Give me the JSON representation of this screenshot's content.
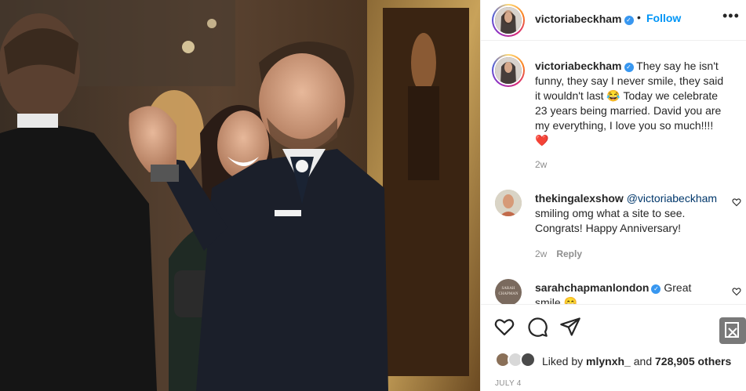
{
  "post": {
    "author": "victoriabeckham",
    "follow_label": "Follow",
    "separator": "•",
    "more_icon": "more-horizontal-icon"
  },
  "caption": {
    "username": "victoriabeckham",
    "lines": [
      "They say he isn't",
      "funny, they say I never smile, they said",
      "it wouldn't last 😂 Today we celebrate",
      "23 years being married. David you are",
      "my everything, I love you so much!!!!",
      "❤️"
    ],
    "time": "2w"
  },
  "comments": [
    {
      "username": "thekingalexshow",
      "lines": [
        "@victoriabeckham",
        "smiling omg what a site to see.",
        "Congrats! Happy Anniversary!"
      ],
      "time": "2w",
      "reply_label": "Reply"
    },
    {
      "username": "sarahchapmanlondon",
      "lines": [
        "Great",
        "smile 😄"
      ],
      "avatar_text": "SARAH CHAPMAN"
    }
  ],
  "actions": {
    "like_icon": "heart-icon",
    "comment_icon": "comment-icon",
    "share_icon": "send-icon",
    "save_icon": "bookmark-icon"
  },
  "likes": {
    "prefix": "Liked by",
    "user": "mlynxh_",
    "connector": "and",
    "count": "728,905 others"
  },
  "date": "JULY 4",
  "colors": {
    "accent": "#0095f6",
    "verified": "#3897f0",
    "muted": "#8e8e8e",
    "text": "#262626"
  }
}
